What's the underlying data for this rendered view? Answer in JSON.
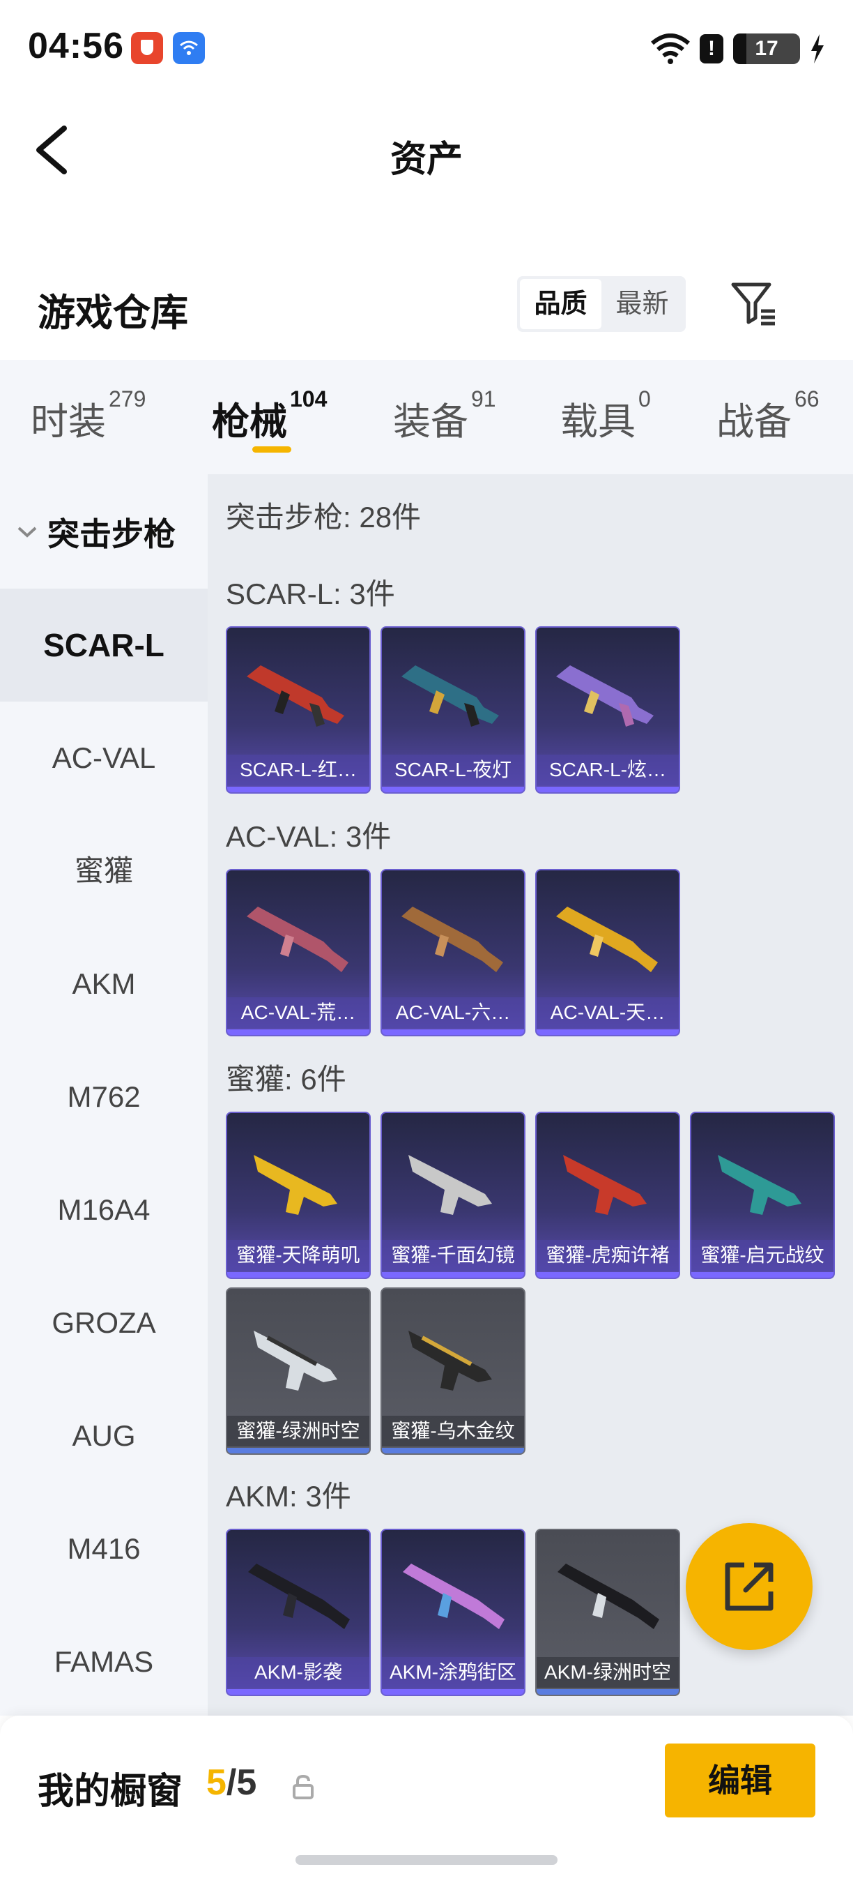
{
  "status_bar": {
    "time": "04:56",
    "battery": "17"
  },
  "header": {
    "title": "资产"
  },
  "warehouse": {
    "title": "游戏仓库",
    "sort_options": [
      "品质",
      "最新"
    ],
    "sort_selected": "品质"
  },
  "tabs": [
    {
      "label": "时装",
      "count": "279"
    },
    {
      "label": "枪械",
      "count": "104",
      "active": true
    },
    {
      "label": "装备",
      "count": "91"
    },
    {
      "label": "载具",
      "count": "0"
    },
    {
      "label": "战备",
      "count": "66"
    }
  ],
  "sidebar": {
    "group": "突击步枪",
    "items": [
      "SCAR-L",
      "AC-VAL",
      "蜜獾",
      "AKM",
      "M762",
      "M16A4",
      "GROZA",
      "AUG",
      "M416",
      "FAMAS"
    ],
    "selected": "SCAR-L"
  },
  "content": {
    "total": "突击步枪: 28件",
    "groups": [
      {
        "title": "SCAR-L: 3件",
        "items": [
          "SCAR-L-红…",
          "SCAR-L-夜灯",
          "SCAR-L-炫…"
        ]
      },
      {
        "title": "AC-VAL: 3件",
        "items": [
          "AC-VAL-荒…",
          "AC-VAL-六…",
          "AC-VAL-天…"
        ]
      },
      {
        "title": "蜜獾: 6件",
        "items": [
          "蜜獾-天降萌叽",
          "蜜獾-千面幻镜",
          "蜜獾-虎痴许褚",
          "蜜獾-启元战纹",
          "蜜獾-绿洲时空",
          "蜜獾-乌木金纹"
        ]
      },
      {
        "title": "AKM: 3件",
        "items": [
          "AKM-影袭",
          "AKM-涂鸦街区",
          "AKM-绿洲时空"
        ]
      }
    ]
  },
  "showcase": {
    "label": "我的橱窗",
    "current": "5",
    "separator": "/",
    "max": "5",
    "edit_label": "编辑"
  },
  "colors": {
    "accent": "#f6b400",
    "card_purple": "#3a3770",
    "card_grey": "#5b5d66"
  }
}
